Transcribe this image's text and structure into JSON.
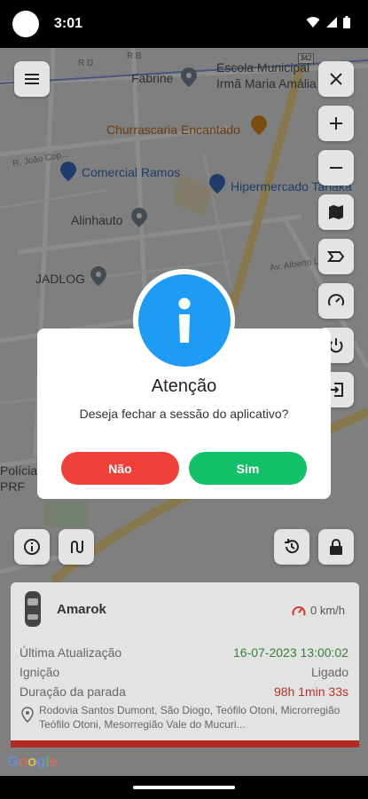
{
  "status_bar": {
    "time": "3:01"
  },
  "map": {
    "labels": {
      "fabrine": "Fabrine",
      "escola": "Escola Municipal",
      "irma": "Irmã Maria Amália",
      "churrascaria": "Churrascaria Encantado",
      "comercial": "Comercial Ramos",
      "hipermercado": "Hipermercado Tanaka",
      "alinhauto": "Alinhauto",
      "jadlog": "JADLOG",
      "street_jose": "R. João Cop...",
      "street_alberto": "Av. Alberto Lo...",
      "street_b": "R B",
      "street_d": "R D",
      "policia": "Polícia R...",
      "prf": "PRF",
      "route": "342"
    }
  },
  "dialog": {
    "title": "Atenção",
    "message": "Deseja fechar a sessão do aplicativo?",
    "no_label": "Não",
    "yes_label": "Sim",
    "badge_color": "#1e9bf5",
    "no_color": "#f0403a",
    "yes_color": "#14c068"
  },
  "vehicle": {
    "name": "Amarok",
    "speed": "0 km/h",
    "rows": [
      {
        "label": "Última Atualização",
        "value": "16-07-2023 13:00:02"
      },
      {
        "label": "Ignição",
        "value": "Ligado"
      },
      {
        "label": "Duração da parada",
        "value": "98h 1min 33s"
      }
    ],
    "address": "Rodovia Santos Dumont, São Diogo, Teófilo Otoni, Microrregião Teófilo Otoni, Mesorregião Vale do Mucuri..."
  },
  "google": "Google"
}
